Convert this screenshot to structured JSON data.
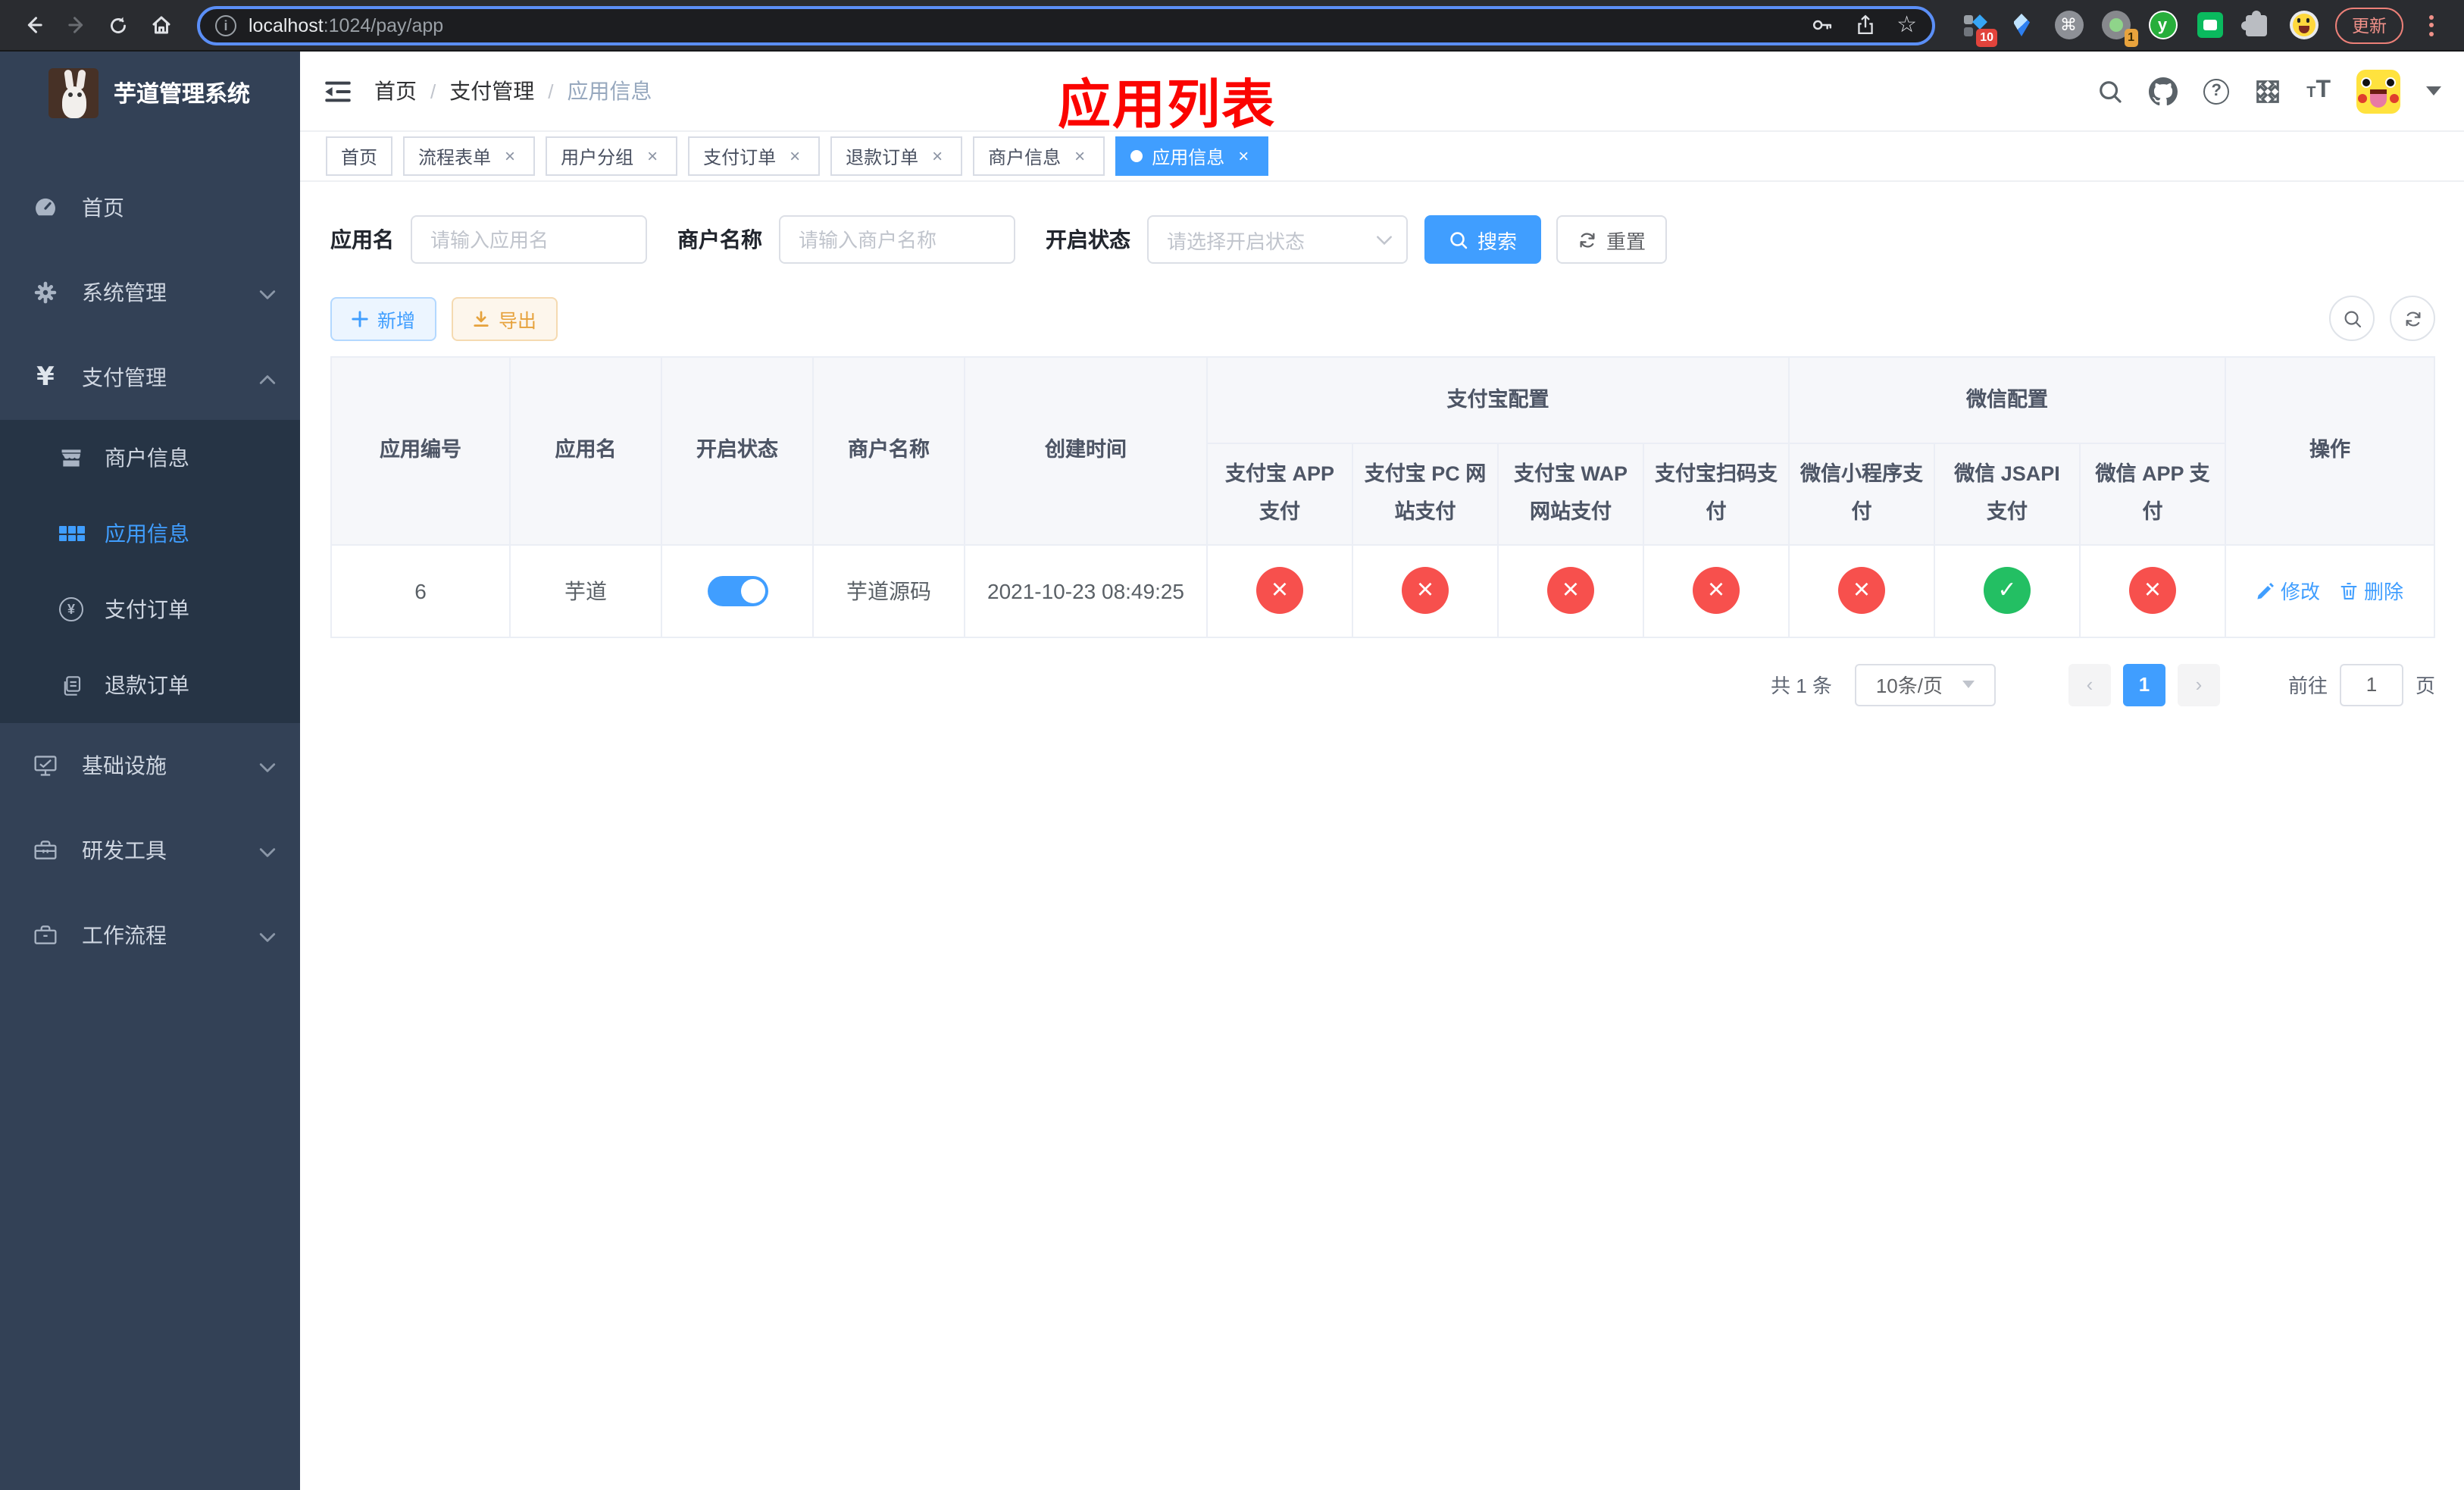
{
  "browser": {
    "url": {
      "host": "localhost",
      "path": ":1024/pay/app"
    },
    "update_label": "更新",
    "ext_badge_grid": "10",
    "ext_badge_proxy": "1",
    "ext_y_letter": "y",
    "ext_cmd_glyph": "⌘"
  },
  "sidebar": {
    "title": "芋道管理系统",
    "items": [
      {
        "label": "首页"
      },
      {
        "label": "系统管理"
      },
      {
        "label": "支付管理"
      },
      {
        "label": "基础设施"
      },
      {
        "label": "研发工具"
      },
      {
        "label": "工作流程"
      }
    ],
    "sub_items": [
      {
        "label": "商户信息"
      },
      {
        "label": "应用信息"
      },
      {
        "label": "支付订单"
      },
      {
        "label": "退款订单"
      }
    ]
  },
  "header": {
    "breadcrumb": [
      "首页",
      "支付管理",
      "应用信息"
    ],
    "annotation": "应用列表"
  },
  "tabs": [
    {
      "label": "首页",
      "closable": false,
      "active": false
    },
    {
      "label": "流程表单",
      "closable": true,
      "active": false
    },
    {
      "label": "用户分组",
      "closable": true,
      "active": false
    },
    {
      "label": "支付订单",
      "closable": true,
      "active": false
    },
    {
      "label": "退款订单",
      "closable": true,
      "active": false
    },
    {
      "label": "商户信息",
      "closable": true,
      "active": false
    },
    {
      "label": "应用信息",
      "closable": true,
      "active": true
    }
  ],
  "filters": {
    "app_name_label": "应用名",
    "app_name_placeholder": "请输入应用名",
    "merchant_label": "商户名称",
    "merchant_placeholder": "请输入商户名称",
    "status_label": "开启状态",
    "status_placeholder": "请选择开启状态",
    "search_label": "搜索",
    "reset_label": "重置"
  },
  "toolbar": {
    "add_label": "新增",
    "export_label": "导出"
  },
  "table": {
    "headers": {
      "app_id": "应用编号",
      "app_name": "应用名",
      "status": "开启状态",
      "merchant": "商户名称",
      "created": "创建时间",
      "alipay_group": "支付宝配置",
      "wechat_group": "微信配置",
      "ops": "操作"
    },
    "channel_headers": [
      "支付宝 APP 支付",
      "支付宝 PC 网站支付",
      "支付宝 WAP 网站支付",
      "支付宝扫码支付",
      "微信小程序支付",
      "微信 JSAPI 支付",
      "微信 APP 支付"
    ],
    "rows": [
      {
        "app_id": "6",
        "app_name": "芋道",
        "status_on": "true",
        "merchant": "芋道源码",
        "created": "2021-10-23 08:49:25",
        "channels": [
          "no",
          "no",
          "no",
          "no",
          "no",
          "yes",
          "no"
        ],
        "edit_label": "修改",
        "delete_label": "删除"
      }
    ]
  },
  "pagination": {
    "total": "共 1 条",
    "page_size": "10条/页",
    "page": "1",
    "goto_prefix": "前往",
    "goto_suffix": "页",
    "goto_value": "1"
  },
  "colors": {
    "accent": "#409eff",
    "annotation_red": "#fb0400",
    "success_green": "#23bf63",
    "danger_red": "#f7504d",
    "warning_orange": "#e6a23c",
    "sidebar_bg": "#334156",
    "submenu_bg": "#263445"
  }
}
